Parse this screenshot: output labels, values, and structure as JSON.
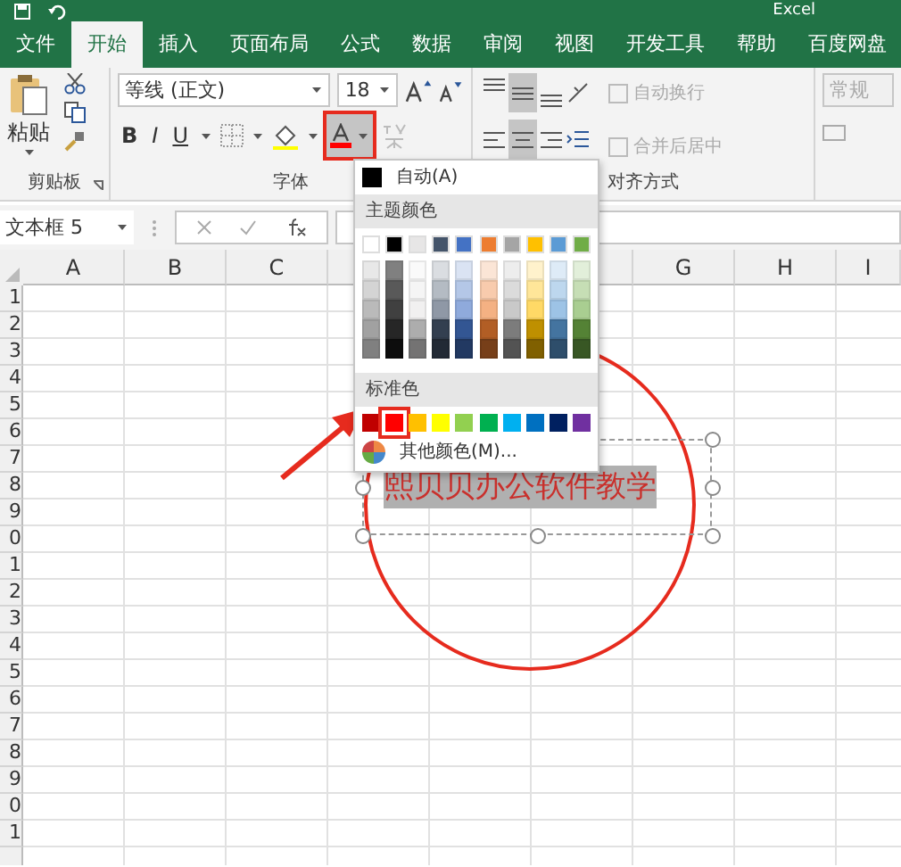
{
  "window": {
    "title": "Excel"
  },
  "tabs": [
    {
      "label": "文件",
      "selected": false
    },
    {
      "label": "开始",
      "selected": true
    },
    {
      "label": "插入",
      "selected": false
    },
    {
      "label": "页面布局",
      "selected": false
    },
    {
      "label": "公式",
      "selected": false
    },
    {
      "label": "数据",
      "selected": false
    },
    {
      "label": "审阅",
      "selected": false
    },
    {
      "label": "视图",
      "selected": false
    },
    {
      "label": "开发工具",
      "selected": false
    },
    {
      "label": "帮助",
      "selected": false
    },
    {
      "label": "百度网盘",
      "selected": false
    }
  ],
  "ribbon": {
    "clipboard": {
      "paste_label": "粘贴",
      "group_label": "剪贴板"
    },
    "font": {
      "font_name": "等线 (正文)",
      "font_size": "18",
      "group_label": "字体",
      "bold": "B",
      "italic": "I",
      "underline": "U"
    },
    "alignment": {
      "group_label": "对齐方式",
      "vertical": [
        {
          "kind": "top",
          "selected": false
        },
        {
          "kind": "middle",
          "selected": true
        },
        {
          "kind": "bottom",
          "selected": false
        }
      ],
      "horizontal": [
        {
          "kind": "left",
          "selected": false
        },
        {
          "kind": "center",
          "selected": true
        },
        {
          "kind": "right",
          "selected": false
        }
      ]
    },
    "wrap": [
      {
        "label": "自动换行",
        "disabled": true
      },
      {
        "label": "合并后居中",
        "disabled": true
      }
    ],
    "number": {
      "format": "常规",
      "disabled": true
    }
  },
  "formula_bar": {
    "name_box": "文本框 5"
  },
  "sheet": {
    "column_headers_left": [
      "A",
      "B",
      "C"
    ],
    "column_headers_right": [
      "G",
      "H",
      "I"
    ],
    "row_headers": [
      "1",
      "2",
      "3",
      "4",
      "5",
      "6",
      "7",
      "8",
      "9",
      "0",
      "1",
      "2",
      "3",
      "4",
      "5",
      "6",
      "7",
      "8",
      "9",
      "0",
      "1"
    ]
  },
  "text_box": {
    "text": "熙贝贝办公软件教学"
  },
  "color_menu": {
    "automatic": "自动(A)",
    "theme_header": "主题颜色",
    "theme_colors": [
      {
        "color": "#ffffff"
      },
      {
        "color": "#000000"
      },
      {
        "color": "#e7e6e6"
      },
      {
        "color": "#44546a"
      },
      {
        "color": "#4472c4"
      },
      {
        "color": "#ed7d31"
      },
      {
        "color": "#a5a5a5"
      },
      {
        "color": "#ffc000"
      },
      {
        "color": "#5b9bd5"
      },
      {
        "color": "#70ad47"
      }
    ],
    "standard_header": "标准色",
    "standard_colors": [
      {
        "color": "#c00000",
        "selected": false
      },
      {
        "color": "#ff0000",
        "selected": true
      },
      {
        "color": "#ffc000",
        "selected": false
      },
      {
        "color": "#ffff00",
        "selected": false
      },
      {
        "color": "#92d050",
        "selected": false
      },
      {
        "color": "#00b050",
        "selected": false
      },
      {
        "color": "#00b0f0",
        "selected": false
      },
      {
        "color": "#0070c0",
        "selected": false
      },
      {
        "color": "#002060",
        "selected": false
      },
      {
        "color": "#7030a0",
        "selected": false
      }
    ],
    "more_colors": "其他颜色(M)..."
  }
}
